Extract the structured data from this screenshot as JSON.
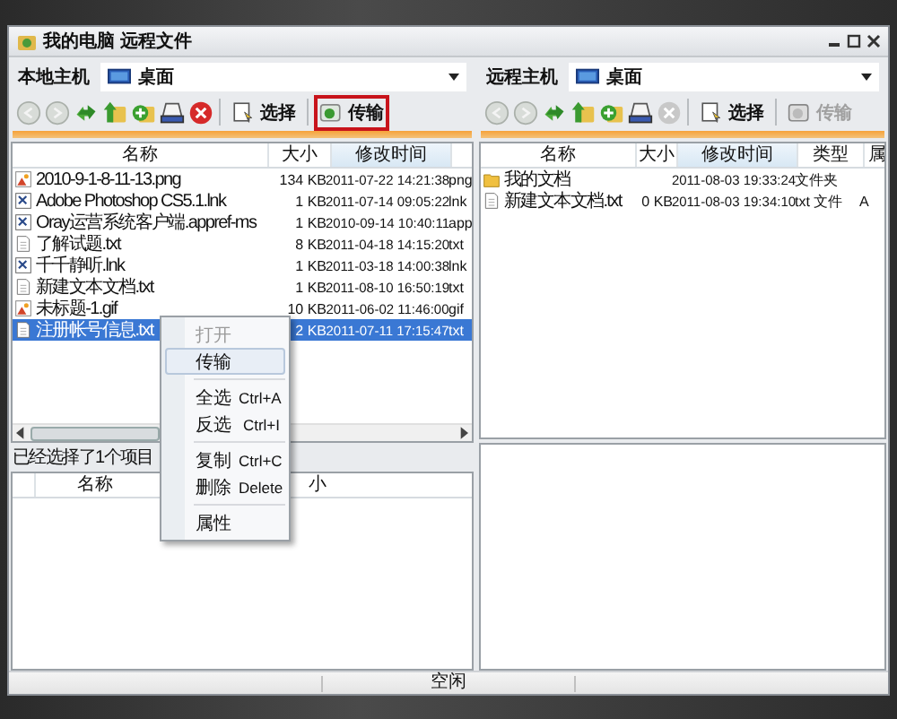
{
  "window": {
    "title": "我的电脑 远程文件"
  },
  "panes": [
    {
      "host_label": "本地主机",
      "location": "桌面",
      "toolbar": [
        {
          "kind": "back",
          "disabled": true
        },
        {
          "kind": "forward",
          "disabled": true
        },
        {
          "kind": "refresh",
          "disabled": false
        },
        {
          "kind": "up",
          "disabled": false
        },
        {
          "kind": "new_folder",
          "disabled": false
        },
        {
          "kind": "drive",
          "disabled": false
        },
        {
          "kind": "stop",
          "disabled": false
        },
        {
          "kind": "select",
          "label": "选择",
          "disabled": false,
          "highlighted": false
        },
        {
          "kind": "transfer",
          "label": "传输",
          "disabled": false,
          "highlighted": true
        }
      ],
      "columns": [
        {
          "label": "名称",
          "sorted": false
        },
        {
          "label": "大小",
          "sorted": false
        },
        {
          "label": "修改时间",
          "sorted": true
        }
      ],
      "rows": [
        {
          "kind": "image",
          "cells": [
            "2010-9-1-8-11-13.png",
            "134 KB",
            "2011-07-22 14:21:38",
            "png"
          ],
          "selected": false
        },
        {
          "kind": "shortcut",
          "cells": [
            "Adobe Photoshop CS5.1.lnk",
            "1 KB",
            "2011-07-14 09:05:22",
            "lnk"
          ],
          "selected": false
        },
        {
          "kind": "shortcut",
          "cells": [
            "Oray运营系统客户端.appref-ms",
            "1 KB",
            "2010-09-14 10:40:11",
            "app"
          ],
          "selected": false
        },
        {
          "kind": "text",
          "cells": [
            "了解试题.txt",
            "8 KB",
            "2011-04-18 14:15:20",
            "txt"
          ],
          "selected": false
        },
        {
          "kind": "shortcut",
          "cells": [
            "千千静听.lnk",
            "1 KB",
            "2011-03-18 14:00:38",
            "lnk"
          ],
          "selected": false
        },
        {
          "kind": "text",
          "cells": [
            "新建文本文档.txt",
            "1 KB",
            "2011-08-10 16:50:19",
            "txt"
          ],
          "selected": false
        },
        {
          "kind": "image",
          "cells": [
            "未标题-1.gif",
            "10 KB",
            "2011-06-02 11:46:00",
            "gif"
          ],
          "selected": false
        },
        {
          "kind": "text",
          "cells": [
            "注册帐号信息.txt",
            "2 KB",
            "2011-07-11 17:15:47",
            "txt"
          ],
          "selected": true
        }
      ],
      "status": "已经选择了1个项目",
      "queue_columns": [
        {
          "label": "名称"
        },
        {
          "label": "小"
        }
      ]
    },
    {
      "host_label": "远程主机",
      "location": "桌面",
      "toolbar": [
        {
          "kind": "back",
          "disabled": true
        },
        {
          "kind": "forward",
          "disabled": true
        },
        {
          "kind": "refresh",
          "disabled": false
        },
        {
          "kind": "up",
          "disabled": false
        },
        {
          "kind": "new_folder",
          "disabled": false
        },
        {
          "kind": "drive",
          "disabled": false
        },
        {
          "kind": "stop",
          "disabled": true
        },
        {
          "kind": "select",
          "label": "选择",
          "disabled": false,
          "highlighted": false
        },
        {
          "kind": "transfer",
          "label": "传输",
          "disabled": true,
          "highlighted": false
        }
      ],
      "columns": [
        {
          "label": "名称",
          "sorted": false
        },
        {
          "label": "大小",
          "sorted": false
        },
        {
          "label": "修改时间",
          "sorted": true
        },
        {
          "label": "类型",
          "sorted": false
        },
        {
          "label": "属",
          "sorted": false
        }
      ],
      "rows": [
        {
          "kind": "folder",
          "cells": [
            "我的文档",
            "",
            "2011-08-03 19:33:24",
            "文件夹",
            ""
          ],
          "selected": false
        },
        {
          "kind": "text",
          "cells": [
            "新建文本文档.txt",
            "0 KB",
            "2011-08-03 19:34:10",
            "txt 文件",
            "A"
          ],
          "selected": false
        }
      ]
    }
  ],
  "context_menu": [
    {
      "kind": "item",
      "label": "打开",
      "disabled": true,
      "selected": false
    },
    {
      "kind": "item",
      "label": "传输",
      "disabled": false,
      "selected": true
    },
    {
      "kind": "separator"
    },
    {
      "kind": "item",
      "label": "全选",
      "shortcut": "Ctrl+A",
      "disabled": false,
      "selected": false
    },
    {
      "kind": "item",
      "label": "反选",
      "shortcut": "Ctrl+I",
      "disabled": false,
      "selected": false
    },
    {
      "kind": "separator"
    },
    {
      "kind": "item",
      "label": "复制",
      "shortcut": "Ctrl+C",
      "disabled": false,
      "selected": false
    },
    {
      "kind": "item",
      "label": "删除",
      "shortcut": "Delete",
      "disabled": false,
      "selected": false
    },
    {
      "kind": "separator"
    },
    {
      "kind": "item",
      "label": "属性",
      "disabled": false,
      "selected": false
    }
  ],
  "status_bar": "空闲"
}
